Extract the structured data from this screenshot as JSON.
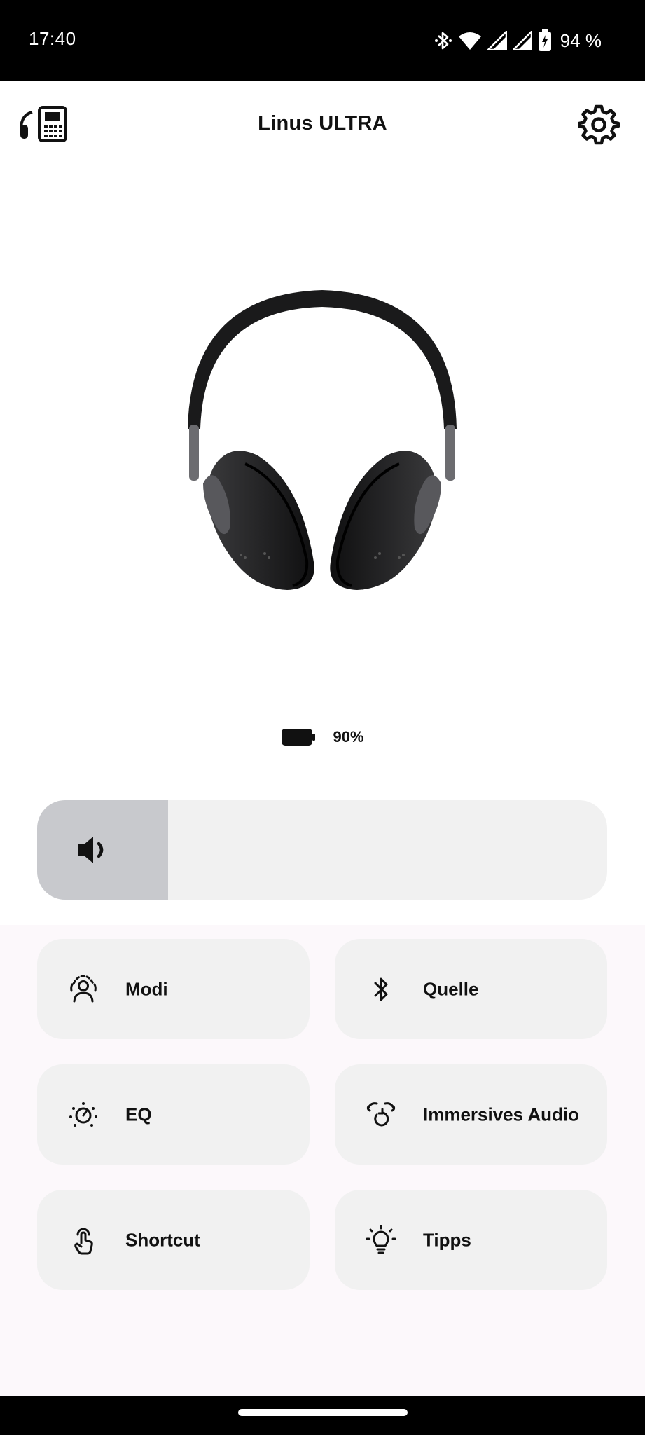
{
  "status_bar": {
    "time": "17:40",
    "battery": "94 %",
    "icons": [
      "bluetooth-icon",
      "wifi-icon",
      "signal-icon",
      "signal-icon",
      "battery-charging-icon"
    ]
  },
  "header": {
    "title": "Linus ULTRA",
    "left_icon": "headphones-phone-icon",
    "right_icon": "gear-icon"
  },
  "device": {
    "image": "headphones-image",
    "battery": "90%"
  },
  "volume": {
    "icon": "speaker-icon",
    "level": 0.23
  },
  "tiles": [
    {
      "label": "Modi",
      "icon": "person-listening-icon"
    },
    {
      "label": "Quelle",
      "icon": "bluetooth-icon"
    },
    {
      "label": "EQ",
      "icon": "eq-dial-icon"
    },
    {
      "label": "Immersives Audio",
      "icon": "immersive-audio-icon"
    },
    {
      "label": "Shortcut",
      "icon": "touch-hand-icon"
    },
    {
      "label": "Tipps",
      "icon": "lightbulb-icon"
    }
  ],
  "colors": {
    "status_bar": "#000000",
    "tile_bg": "#f1f1f1",
    "volume_fill": "#c8c9cd",
    "lower_bg": "#fcf8fb"
  }
}
